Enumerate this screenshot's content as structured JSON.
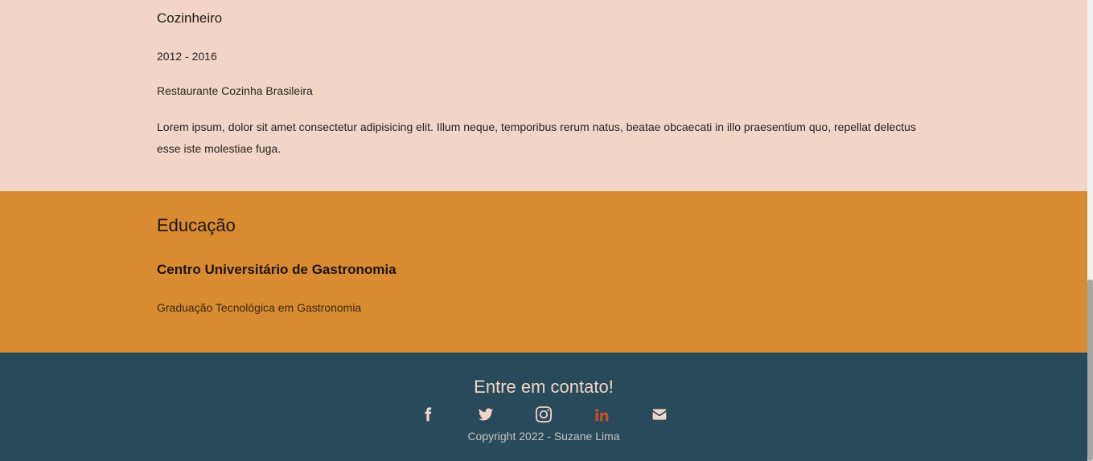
{
  "experience": {
    "job_title": "Cozinheiro",
    "dates": "2012 - 2016",
    "company": "Restaurante Cozinha Brasileira",
    "description": "Lorem ipsum, dolor sit amet consectetur adipisicing elit. Illum neque, temporibus rerum natus, beatae obcaecati in illo praesentium quo, repellat delectus esse iste molestiae fuga."
  },
  "education": {
    "heading": "Educação",
    "school": "Centro Universitário de Gastronomia",
    "degree": "Graduação Tecnológica em Gastronomia"
  },
  "footer": {
    "heading": "Entre em contato!",
    "social": [
      {
        "icon": "facebook-icon"
      },
      {
        "icon": "twitter-icon"
      },
      {
        "icon": "instagram-icon"
      },
      {
        "icon": "linkedin-icon",
        "active": true
      },
      {
        "icon": "envelope-icon"
      }
    ],
    "copyright": "Copyright 2022 - Suzane Lima"
  },
  "colors": {
    "experience_bg": "#f2d5c6",
    "education_bg": "#d98b31",
    "footer_bg": "#284a5a",
    "icon_default": "#f2d5c6",
    "icon_active": "#c1502a"
  }
}
